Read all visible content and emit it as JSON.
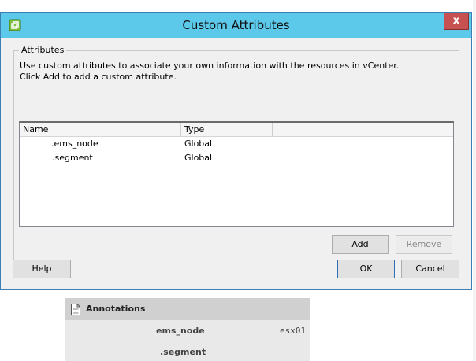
{
  "dialog": {
    "title": "Custom Attributes",
    "close_label": "x",
    "group_label": "Attributes",
    "description_line1": "Use custom attributes to associate your own information with the resources in vCenter.",
    "description_line2": "Click Add to add a custom attribute.",
    "columns": [
      "Name",
      "Type",
      ""
    ],
    "rows": [
      {
        "name": ".ems_node",
        "type": "Global"
      },
      {
        "name": ".segment",
        "type": "Global"
      }
    ],
    "add_label": "Add",
    "remove_label": "Remove",
    "help_label": "Help",
    "ok_label": "OK",
    "cancel_label": "Cancel"
  },
  "annotations": {
    "title": "Annotations",
    "entries": [
      {
        "key": "ems_node",
        "value": "esx01"
      },
      {
        "key": ".segment",
        "value": ""
      }
    ]
  },
  "colors": {
    "titlebar": "#5dc9ea",
    "close_button": "#c75050",
    "dialog_bg": "#f0f0f0"
  },
  "icons": {
    "app": "vsphere-client-icon",
    "annotations": "document-icon"
  }
}
